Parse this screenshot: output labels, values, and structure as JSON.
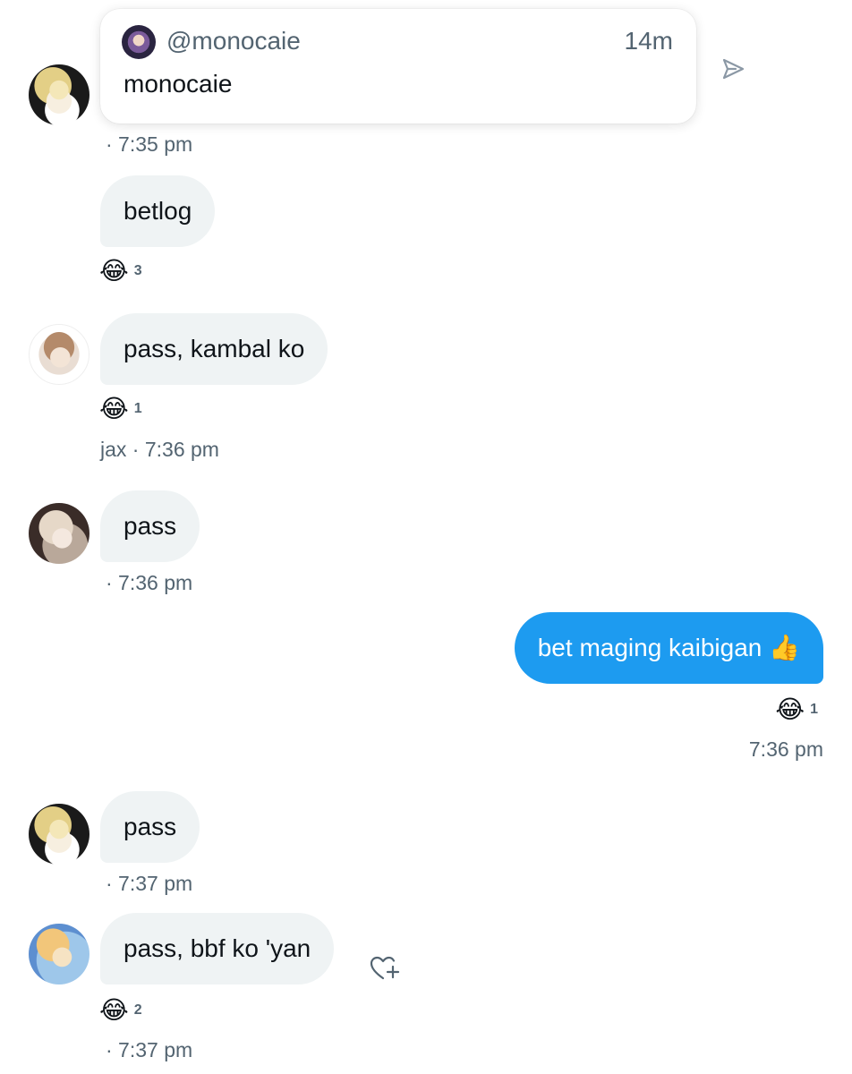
{
  "quote_card": {
    "handle": "@monocaie",
    "time_ago": "14m",
    "text": "monocaie"
  },
  "messages": [
    {
      "time": "· 7:35 pm"
    },
    {
      "text": "betlog",
      "reaction": {
        "emoji": "😂",
        "count": "3"
      }
    },
    {
      "text": "pass, kambal ko",
      "reaction": {
        "emoji": "😂",
        "count": "1"
      },
      "sender": "jax",
      "time": "· 7:36 pm"
    },
    {
      "text": "pass",
      "time": "· 7:36 pm"
    },
    {
      "text": "bet maging kaibigan 👍",
      "reaction": {
        "emoji": "😂",
        "count": "1"
      },
      "time": "7:36 pm"
    },
    {
      "text": "pass",
      "time": "· 7:37 pm"
    },
    {
      "text": "pass, bbf ko 'yan",
      "reaction": {
        "emoji": "😂",
        "count": "2"
      },
      "time": "· 7:37 pm"
    }
  ],
  "colors": {
    "my_bubble": "#1d9bf0",
    "other_bubble": "#eff3f4",
    "meta_text": "#536471"
  },
  "icons": {
    "share": "send-icon",
    "add_reaction": "heart-plus-icon"
  }
}
